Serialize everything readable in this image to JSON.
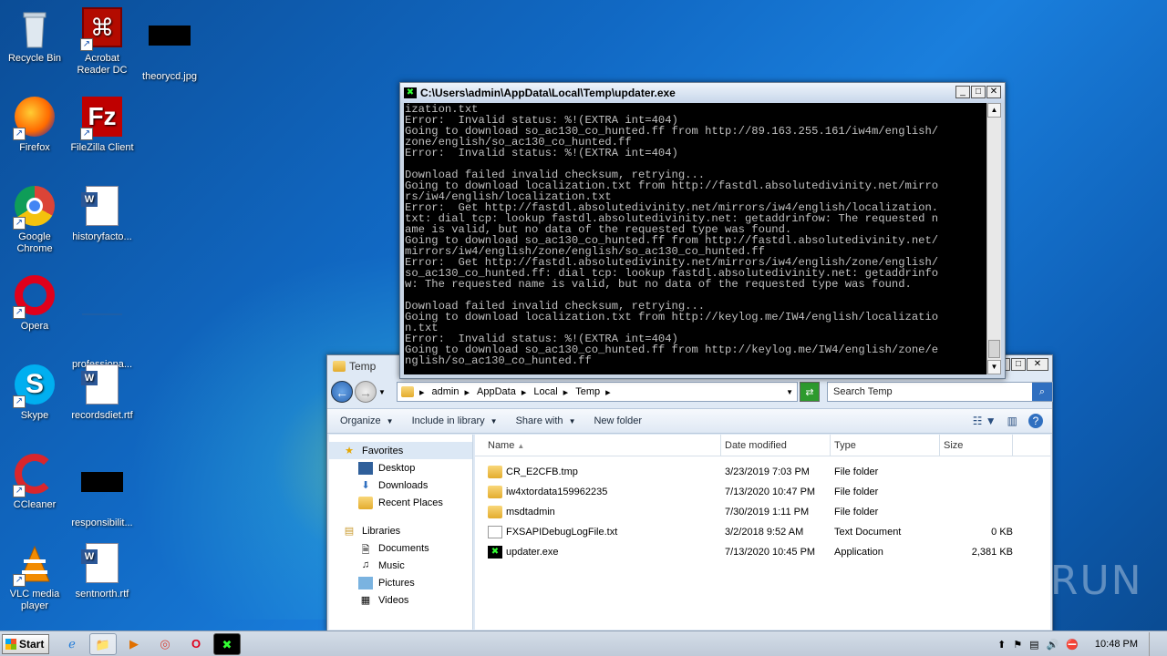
{
  "desktop": {
    "icons": [
      {
        "label": "Recycle Bin"
      },
      {
        "label": "Acrobat Reader DC"
      },
      {
        "label": "theorycd.jpg"
      },
      {
        "label": "Firefox"
      },
      {
        "label": "FileZilla Client"
      },
      {
        "label": "Google Chrome"
      },
      {
        "label": "historyfacto..."
      },
      {
        "label": "Opera"
      },
      {
        "label": "professiona..."
      },
      {
        "label": "Skype"
      },
      {
        "label": "recordsdiet.rtf"
      },
      {
        "label": "CCleaner"
      },
      {
        "label": "responsibilit..."
      },
      {
        "label": "VLC media player"
      },
      {
        "label": "sentnorth.rtf"
      }
    ]
  },
  "console": {
    "title": "C:\\Users\\admin\\AppData\\Local\\Temp\\updater.exe",
    "text": "ization.txt\nError:  Invalid status: %!(EXTRA int=404)\nGoing to download so_ac130_co_hunted.ff from http://89.163.255.161/iw4m/english/\nzone/english/so_ac130_co_hunted.ff\nError:  Invalid status: %!(EXTRA int=404)\n\nDownload failed invalid checksum, retrying...\nGoing to download localization.txt from http://fastdl.absolutedivinity.net/mirro\nrs/iw4/english/localization.txt\nError:  Get http://fastdl.absolutedivinity.net/mirrors/iw4/english/localization.\ntxt: dial tcp: lookup fastdl.absolutedivinity.net: getaddrinfow: The requested n\name is valid, but no data of the requested type was found.\nGoing to download so_ac130_co_hunted.ff from http://fastdl.absolutedivinity.net/\nmirrors/iw4/english/zone/english/so_ac130_co_hunted.ff\nError:  Get http://fastdl.absolutedivinity.net/mirrors/iw4/english/zone/english/\nso_ac130_co_hunted.ff: dial tcp: lookup fastdl.absolutedivinity.net: getaddrinfo\nw: The requested name is valid, but no data of the requested type was found.\n\nDownload failed invalid checksum, retrying...\nGoing to download localization.txt from http://keylog.me/IW4/english/localizatio\nn.txt\nError:  Invalid status: %!(EXTRA int=404)\nGoing to download so_ac130_co_hunted.ff from http://keylog.me/IW4/english/zone/e\nnglish/so_ac130_co_hunted.ff"
  },
  "explorer": {
    "title": "Temp",
    "breadcrumb": [
      "admin",
      "AppData",
      "Local",
      "Temp"
    ],
    "search_placeholder": "Search Temp",
    "toolbar": {
      "organize": "Organize",
      "include": "Include in library",
      "share": "Share with",
      "new_folder": "New folder"
    },
    "nav": {
      "favorites": "Favorites",
      "desktop": "Desktop",
      "downloads": "Downloads",
      "recent": "Recent Places",
      "libraries": "Libraries",
      "documents": "Documents",
      "music": "Music",
      "pictures": "Pictures",
      "videos": "Videos"
    },
    "columns": {
      "name": "Name",
      "date": "Date modified",
      "type": "Type",
      "size": "Size"
    },
    "files": [
      {
        "name": "CR_E2CFB.tmp",
        "date": "3/23/2019 7:03 PM",
        "type": "File folder",
        "size": ""
      },
      {
        "name": "iw4xtordata159962235",
        "date": "7/13/2020 10:47 PM",
        "type": "File folder",
        "size": ""
      },
      {
        "name": "msdtadmin",
        "date": "7/30/2019 1:11 PM",
        "type": "File folder",
        "size": ""
      },
      {
        "name": "FXSAPIDebugLogFile.txt",
        "date": "3/2/2018 9:52 AM",
        "type": "Text Document",
        "size": "0 KB"
      },
      {
        "name": "updater.exe",
        "date": "7/13/2020 10:45 PM",
        "type": "Application",
        "size": "2,381 KB"
      }
    ]
  },
  "taskbar": {
    "start": "Start",
    "clock": "10:48 PM"
  },
  "watermark": "ANY RUN"
}
